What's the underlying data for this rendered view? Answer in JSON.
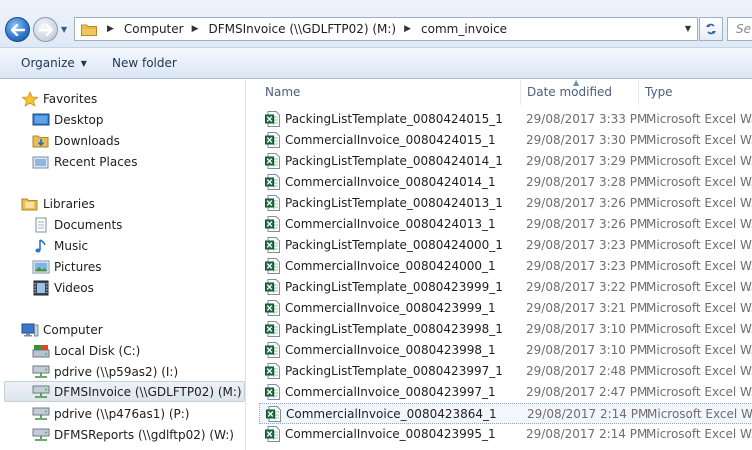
{
  "address": {
    "crumbs": [
      "Computer",
      "DFMSInvoice (\\\\GDLFTP02) (M:)",
      "comm_invoice"
    ],
    "search_placeholder": "Se"
  },
  "toolbar": {
    "organize_label": "Organize",
    "new_folder_label": "New folder"
  },
  "nav": {
    "favorites_label": "Favorites",
    "desktop_label": "Desktop",
    "downloads_label": "Downloads",
    "recent_label": "Recent Places",
    "libraries_label": "Libraries",
    "documents_label": "Documents",
    "music_label": "Music",
    "pictures_label": "Pictures",
    "videos_label": "Videos",
    "computer_label": "Computer",
    "drives": [
      "Local Disk (C:)",
      "pdrive (\\\\p59as2) (I:)",
      "DFMSInvoice (\\\\GDLFTP02) (M:)",
      "pdrive (\\\\p476as1) (P:)",
      "DFMSReports (\\\\gdlftp02) (W:)"
    ],
    "selected_drive": "DFMSInvoice (\\\\GDLFTP02) (M:)"
  },
  "columns": {
    "name": "Name",
    "date": "Date modified",
    "type": "Type"
  },
  "files": [
    {
      "name": "PackingListTemplate_0080424015_1",
      "date": "29/08/2017 3:33 PM",
      "type": "Microsoft Excel W..."
    },
    {
      "name": "CommercialInvoice_0080424015_1",
      "date": "29/08/2017 3:30 PM",
      "type": "Microsoft Excel W..."
    },
    {
      "name": "PackingListTemplate_0080424014_1",
      "date": "29/08/2017 3:29 PM",
      "type": "Microsoft Excel W..."
    },
    {
      "name": "CommercialInvoice_0080424014_1",
      "date": "29/08/2017 3:28 PM",
      "type": "Microsoft Excel W..."
    },
    {
      "name": "PackingListTemplate_0080424013_1",
      "date": "29/08/2017 3:26 PM",
      "type": "Microsoft Excel W..."
    },
    {
      "name": "CommercialInvoice_0080424013_1",
      "date": "29/08/2017 3:26 PM",
      "type": "Microsoft Excel W..."
    },
    {
      "name": "PackingListTemplate_0080424000_1",
      "date": "29/08/2017 3:23 PM",
      "type": "Microsoft Excel W..."
    },
    {
      "name": "CommercialInvoice_0080424000_1",
      "date": "29/08/2017 3:23 PM",
      "type": "Microsoft Excel W..."
    },
    {
      "name": "PackingListTemplate_0080423999_1",
      "date": "29/08/2017 3:22 PM",
      "type": "Microsoft Excel W..."
    },
    {
      "name": "CommercialInvoice_0080423999_1",
      "date": "29/08/2017 3:21 PM",
      "type": "Microsoft Excel W..."
    },
    {
      "name": "PackingListTemplate_0080423998_1",
      "date": "29/08/2017 3:10 PM",
      "type": "Microsoft Excel W..."
    },
    {
      "name": "CommercialInvoice_0080423998_1",
      "date": "29/08/2017 3:10 PM",
      "type": "Microsoft Excel W..."
    },
    {
      "name": "PackingListTemplate_0080423997_1",
      "date": "29/08/2017 2:48 PM",
      "type": "Microsoft Excel W..."
    },
    {
      "name": "CommercialInvoice_0080423997_1",
      "date": "29/08/2017 2:47 PM",
      "type": "Microsoft Excel W..."
    },
    {
      "name": "CommercialInvoice_0080423864_1",
      "date": "29/08/2017 2:14 PM",
      "type": "Microsoft Excel W..."
    },
    {
      "name": "CommercialInvoice_0080423995_1",
      "date": "29/08/2017 2:14 PM",
      "type": "Microsoft Excel W..."
    }
  ],
  "focused_file": "CommercialInvoice_0080423864_1",
  "colors": {
    "accent": "#2b73c9",
    "excel_green": "#1e7145",
    "selection": "#dde4ec"
  }
}
